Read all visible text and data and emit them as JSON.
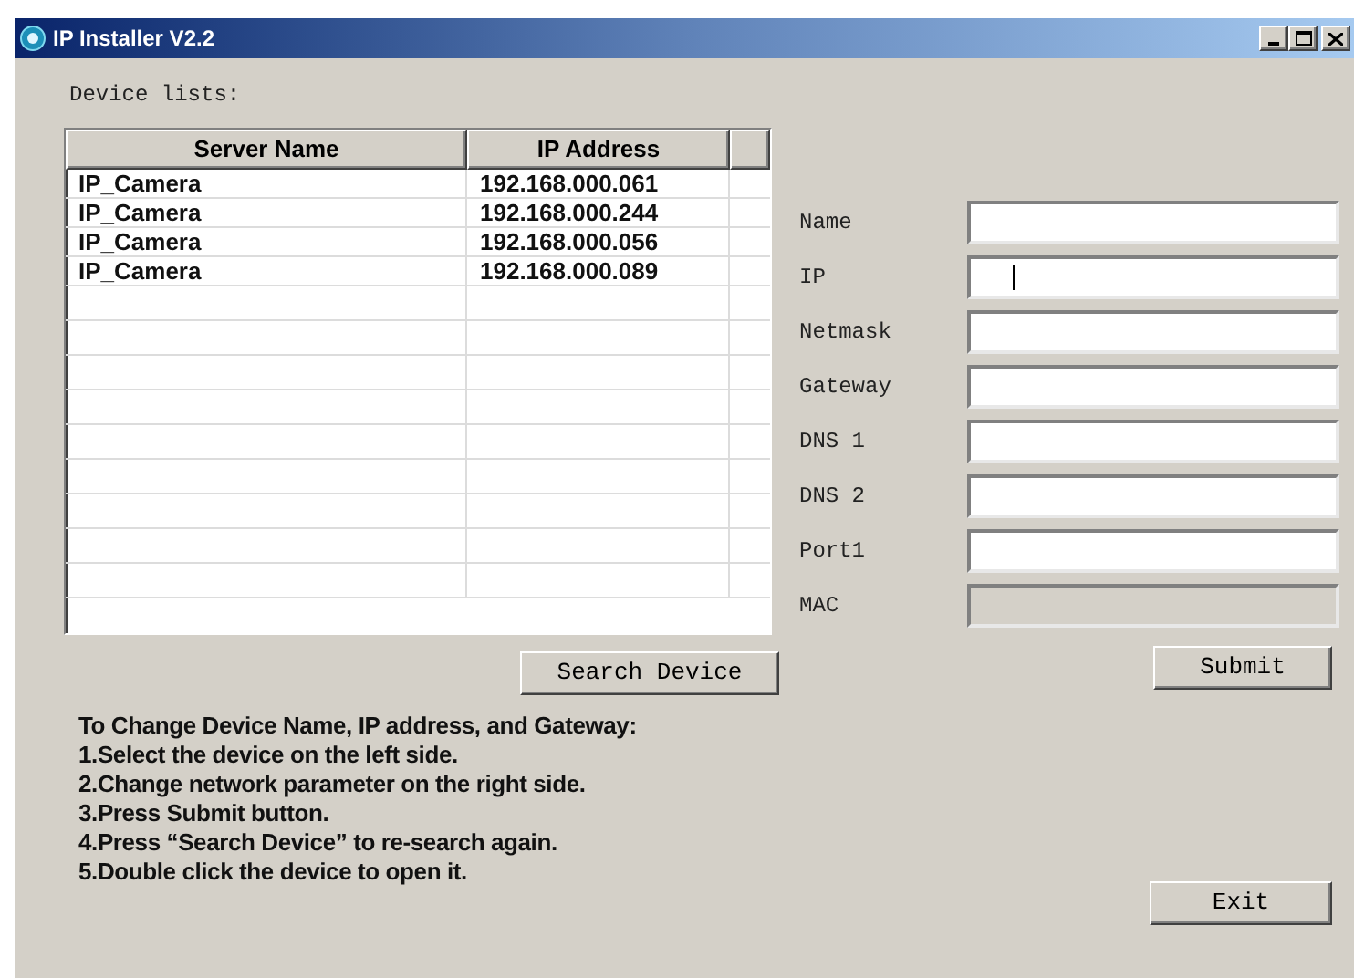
{
  "window": {
    "title": "IP Installer V2.2"
  },
  "device_list": {
    "label": "Device lists:",
    "columns": [
      "Server Name",
      "IP Address"
    ],
    "rows": [
      {
        "cells": [
          "IP_Camera",
          "192.168.000.061"
        ]
      },
      {
        "cells": [
          "IP_Camera",
          "192.168.000.244"
        ]
      },
      {
        "cells": [
          "IP_Camera",
          "192.168.000.056"
        ]
      },
      {
        "cells": [
          "IP_Camera",
          "192.168.000.089"
        ]
      }
    ],
    "search_button": "Search Device"
  },
  "fields": [
    {
      "label": "Name",
      "disabled": false,
      "focused": false
    },
    {
      "label": "IP",
      "disabled": false,
      "focused": true
    },
    {
      "label": "Netmask",
      "disabled": false,
      "focused": false
    },
    {
      "label": "Gateway",
      "disabled": false,
      "focused": false
    },
    {
      "label": "DNS 1",
      "disabled": false,
      "focused": false
    },
    {
      "label": "DNS 2",
      "disabled": false,
      "focused": false
    },
    {
      "label": "Port1",
      "disabled": false,
      "focused": false
    },
    {
      "label": "MAC",
      "disabled": true,
      "focused": false
    }
  ],
  "submit_button": "Submit",
  "instructions": [
    "To Change Device Name, IP address, and Gateway:",
    "1.Select the device on the left side.",
    "2.Change network parameter on the right side.",
    "3.Press Submit button.",
    "4.Press “Search Device” to re-search again.",
    "5.Double click the device to open it."
  ],
  "exit_button": "Exit"
}
